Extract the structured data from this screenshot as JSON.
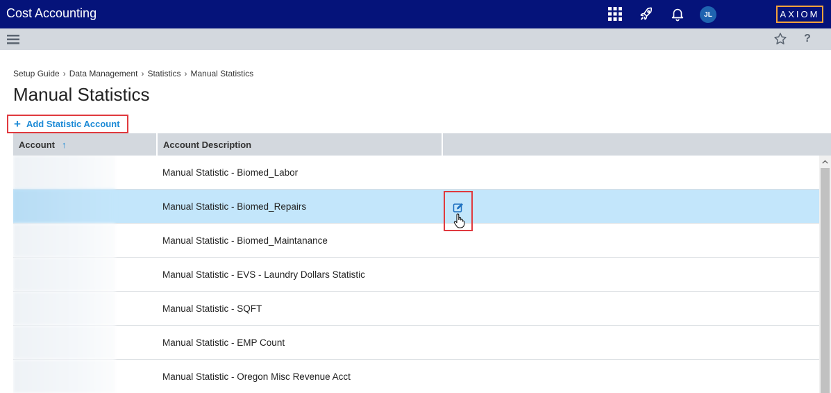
{
  "app": {
    "title": "Cost Accounting",
    "brand": "AXIOM",
    "user_initials": "JL"
  },
  "icons": {
    "apps": "grid-icon",
    "launch": "rocket-icon",
    "notifications": "bell-icon",
    "menu": "hamburger-icon",
    "favorite": "star-icon",
    "help": "question-mark-icon",
    "edit": "edit-icon"
  },
  "toolbar": {
    "help_glyph": "?"
  },
  "breadcrumb": {
    "items": [
      "Setup Guide",
      "Data Management",
      "Statistics"
    ],
    "current": "Manual Statistics",
    "separator": "›"
  },
  "page": {
    "title": "Manual Statistics"
  },
  "actions": {
    "add_plus": "+",
    "add_label": "Add Statistic Account"
  },
  "grid": {
    "columns": [
      "Account",
      "Account Description",
      ""
    ],
    "sort_indicator": "↑",
    "rows": [
      {
        "account": "",
        "description": "Manual Statistic - Biomed_Labor"
      },
      {
        "account": "",
        "description": "Manual Statistic - Biomed_Repairs",
        "selected": true
      },
      {
        "account": "",
        "description": "Manual Statistic - Biomed_Maintanance"
      },
      {
        "account": "",
        "description": "Manual Statistic - EVS - Laundry Dollars Statistic"
      },
      {
        "account": "",
        "description": "Manual Statistic - SQFT"
      },
      {
        "account": "",
        "description": "Manual Statistic - EMP Count"
      },
      {
        "account": "",
        "description": "Manual Statistic - Oregon Misc Revenue Acct"
      }
    ]
  },
  "colors": {
    "topbar": "#05137a",
    "brand_border": "#f3a23a",
    "accent": "#1c8ad6",
    "highlight_border": "#e0393e",
    "selected_row": "#c3e6fb",
    "header_bg": "#d3d8de"
  }
}
